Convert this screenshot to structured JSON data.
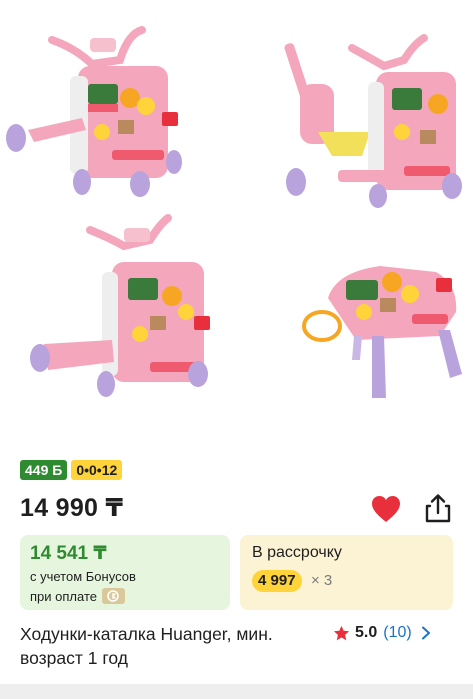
{
  "gallery": {
    "images": [
      {
        "icon": "walker-image"
      },
      {
        "icon": "scooter-image"
      },
      {
        "icon": "walker-side-image"
      },
      {
        "icon": "play-table-image"
      }
    ]
  },
  "badges": {
    "bonus": "449 Б",
    "installment": "0•0•12"
  },
  "price": "14 990 ₸",
  "actions": {
    "favorite_icon": "heart-icon",
    "share_icon": "share-icon",
    "favorite_color": "#e8303c"
  },
  "bonus_card": {
    "price": "14 541 ₸",
    "line1": "с учетом Бонусов",
    "line2": "при оплате",
    "icon": "kaspi-icon"
  },
  "installment_card": {
    "title": "В рассрочку",
    "amount": "4 997",
    "multiplier": "× 3"
  },
  "product": {
    "title": "Ходунки-каталка Huanger, мин. возраст 1 год"
  },
  "rating": {
    "value": "5.0",
    "count": "(10)",
    "star_color": "#e8303c",
    "link_color": "#1a73c8"
  },
  "colors": {
    "green": "#2e8b2f",
    "yellow": "#ffd43b",
    "pink": "#f4a6bd",
    "purple": "#b9a3dc"
  }
}
